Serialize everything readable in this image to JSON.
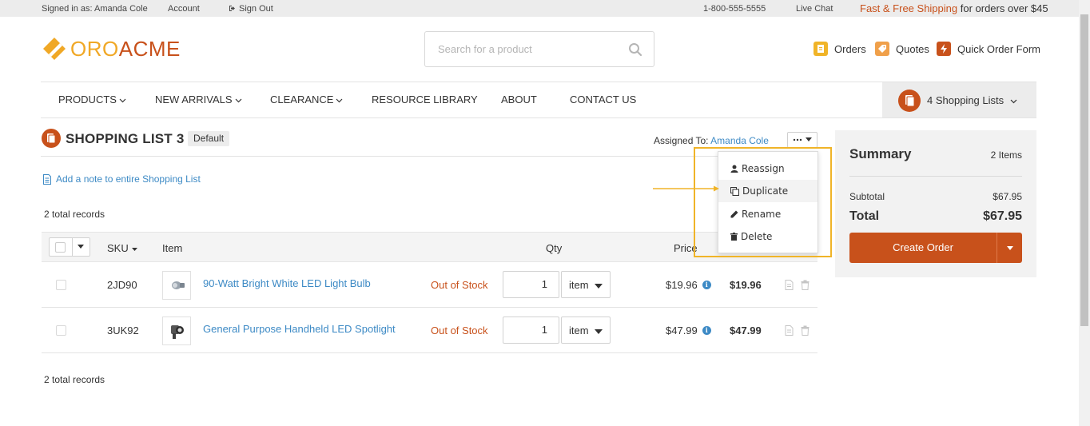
{
  "topbar": {
    "signed_in": "Signed in as: Amanda Cole",
    "account": "Account",
    "sign_out": "Sign Out",
    "phone": "1-800-555-5555",
    "live_chat": "Live Chat",
    "promo_accent": "Fast & Free Shipping",
    "promo_rest": " for orders over $45"
  },
  "header": {
    "logo_part1": "ORO",
    "logo_part2": "ACME",
    "search_placeholder": "Search for a product",
    "links": {
      "orders": "Orders",
      "quotes": "Quotes",
      "quick_order": "Quick Order Form"
    }
  },
  "nav": {
    "items": [
      "PRODUCTS",
      "NEW ARRIVALS",
      "CLEARANCE",
      "RESOURCE LIBRARY",
      "ABOUT",
      "CONTACT US"
    ],
    "shopping_lists": "4 Shopping Lists"
  },
  "page": {
    "title": "SHOPPING LIST 3",
    "badge": "Default",
    "assigned_label": "Assigned To: ",
    "assigned_name": "Amanda Cole",
    "add_note": "Add a note to entire Shopping List",
    "total_records": "2 total records"
  },
  "table": {
    "headers": {
      "sku": "SKU",
      "item": "Item",
      "qty": "Qty",
      "price": "Price"
    },
    "rows": [
      {
        "sku": "2JD90",
        "item": "90-Watt Bright White LED Light Bulb",
        "stock": "Out of Stock",
        "qty": "1",
        "unit": "item",
        "price": "$19.96",
        "subtotal": "$19.96"
      },
      {
        "sku": "3UK92",
        "item": "General Purpose Handheld LED Spotlight",
        "stock": "Out of Stock",
        "qty": "1",
        "unit": "item",
        "price": "$47.99",
        "subtotal": "$47.99"
      }
    ]
  },
  "dropdown": {
    "items": [
      "Reassign",
      "Duplicate",
      "Rename",
      "Delete"
    ]
  },
  "summary": {
    "title": "Summary",
    "count": "2 Items",
    "subtotal_label": "Subtotal",
    "subtotal_value": "$67.95",
    "total_label": "Total",
    "total_value": "$67.95",
    "create_order": "Create Order"
  },
  "colors": {
    "brand": "#c8511b",
    "logo_yellow": "#f0a826",
    "link": "#3d8ac5",
    "highlight": "#f0b428"
  }
}
